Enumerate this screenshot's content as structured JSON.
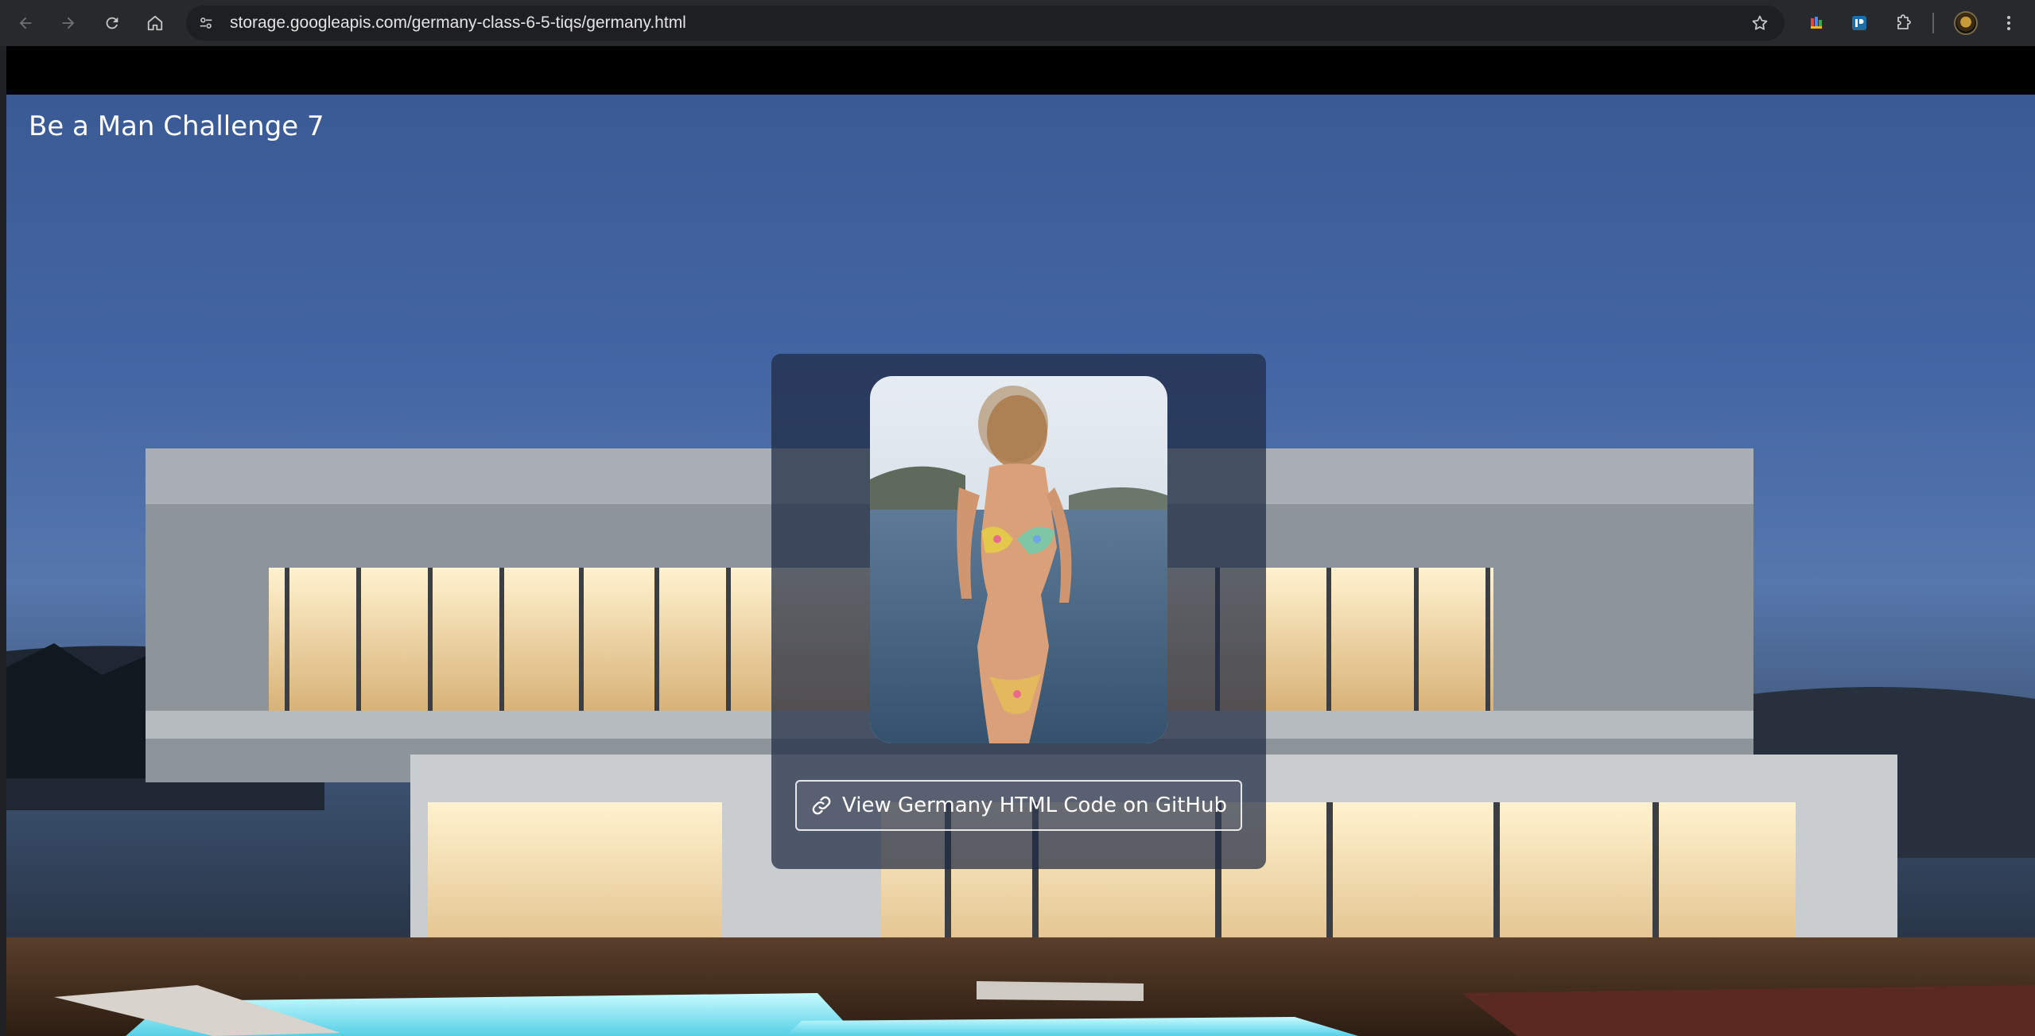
{
  "browser": {
    "url": "storage.googleapis.com/germany-class-6-5-tiqs/germany.html",
    "icons": {
      "back": "arrow-left-icon",
      "forward": "arrow-right-icon",
      "reload": "reload-icon",
      "home": "home-icon",
      "site_info": "tune-icon",
      "bookmark": "star-icon",
      "extension_1": "colorful-bars-icon",
      "extension_2": "blue-square-icon",
      "extensions": "puzzle-icon",
      "profile": "avatar-icon",
      "menu": "more-vertical-icon"
    }
  },
  "page": {
    "title": "Be a Man Challenge 7",
    "button_label": "View Germany HTML Code on GitHub",
    "button_icon": "link-icon"
  },
  "colors": {
    "chrome_bar": "#28292c",
    "omnibox": "#1e1f22",
    "sky_top": "#3a5a95",
    "card_overlay": "#1e2a42",
    "pool": "#7fe6f5",
    "window_glow": "#f4d596"
  }
}
